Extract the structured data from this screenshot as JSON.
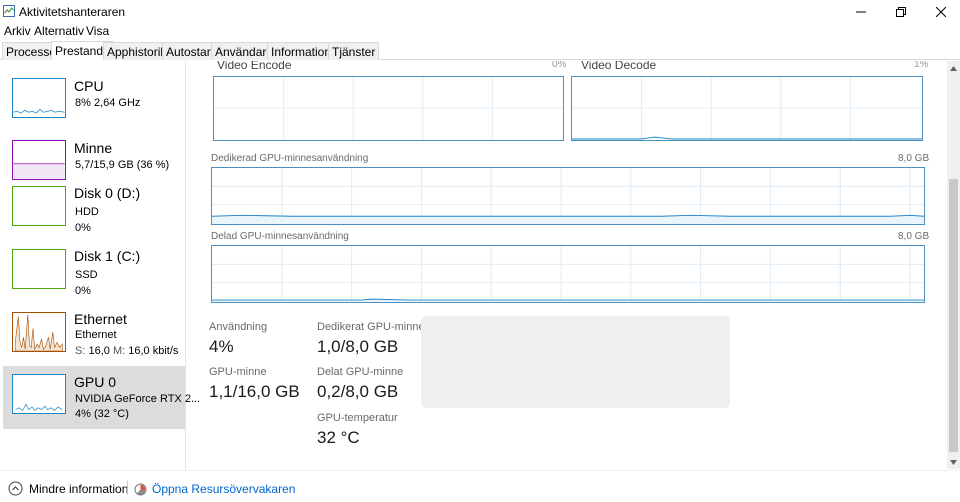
{
  "window": {
    "title": "Aktivitetshanteraren"
  },
  "menu": [
    "Arkiv",
    "Alternativ",
    "Visa"
  ],
  "tabs": [
    "Processer",
    "Prestanda",
    "Apphistorik",
    "Autostart",
    "Användare",
    "Information",
    "Tjänster"
  ],
  "active_tab": "Prestanda",
  "sidebar": {
    "cpu": {
      "title": "CPU",
      "line1": "8%  2,64 GHz",
      "color": "#1e85c8"
    },
    "memory": {
      "title": "Minne",
      "line1": "5,7/15,9 GB (36 %)",
      "color": "#8b12ae"
    },
    "disk0": {
      "title": "Disk 0 (D:)",
      "line1": "HDD",
      "line2": "0%",
      "color": "#4da60c"
    },
    "disk1": {
      "title": "Disk 1 (C:)",
      "line1": "SSD",
      "line2": "0%",
      "color": "#4da60c"
    },
    "ethernet": {
      "title": "Ethernet",
      "line1": "Ethernet",
      "line2_s": "S:",
      "line2_s_val": "16,0",
      "line2_m": "M:",
      "line2_m_val": "16,0 kbit/s",
      "color": "#a74f01"
    },
    "gpu": {
      "title": "GPU 0",
      "line1": "NVIDIA GeForce RTX 2...",
      "line2": "4% (32 °C)",
      "color": "#1e85c8"
    }
  },
  "graphs": {
    "video_encode": {
      "label": "Video Encode",
      "value": "0%"
    },
    "video_decode": {
      "label": "Video Decode",
      "value": "1%"
    },
    "dedicated": {
      "label": "Dedikerad GPU-minnesanvändning",
      "max": "8,0 GB"
    },
    "shared": {
      "label": "Delad GPU-minnesanvändning",
      "max": "8,0 GB"
    }
  },
  "stats": {
    "usage": {
      "label": "Användning",
      "value": "4%"
    },
    "dedicated_mem": {
      "label": "Dedikerat GPU-minne",
      "value": "1,0/8,0 GB"
    },
    "gpu_mem": {
      "label": "GPU-minne",
      "value": "1,1/16,0 GB"
    },
    "shared_mem": {
      "label": "Delat GPU-minne",
      "value": "0,2/8,0 GB"
    },
    "temperature": {
      "label": "GPU-temperatur",
      "value": "32 °C"
    }
  },
  "footer": {
    "fewer_details": "Mindre information",
    "resource_monitor": "Öppna Resursövervakaren"
  },
  "colors": {
    "graph_border": "#4d8fbf",
    "graph_line": "#1e85c8",
    "link": "#0066cc"
  }
}
